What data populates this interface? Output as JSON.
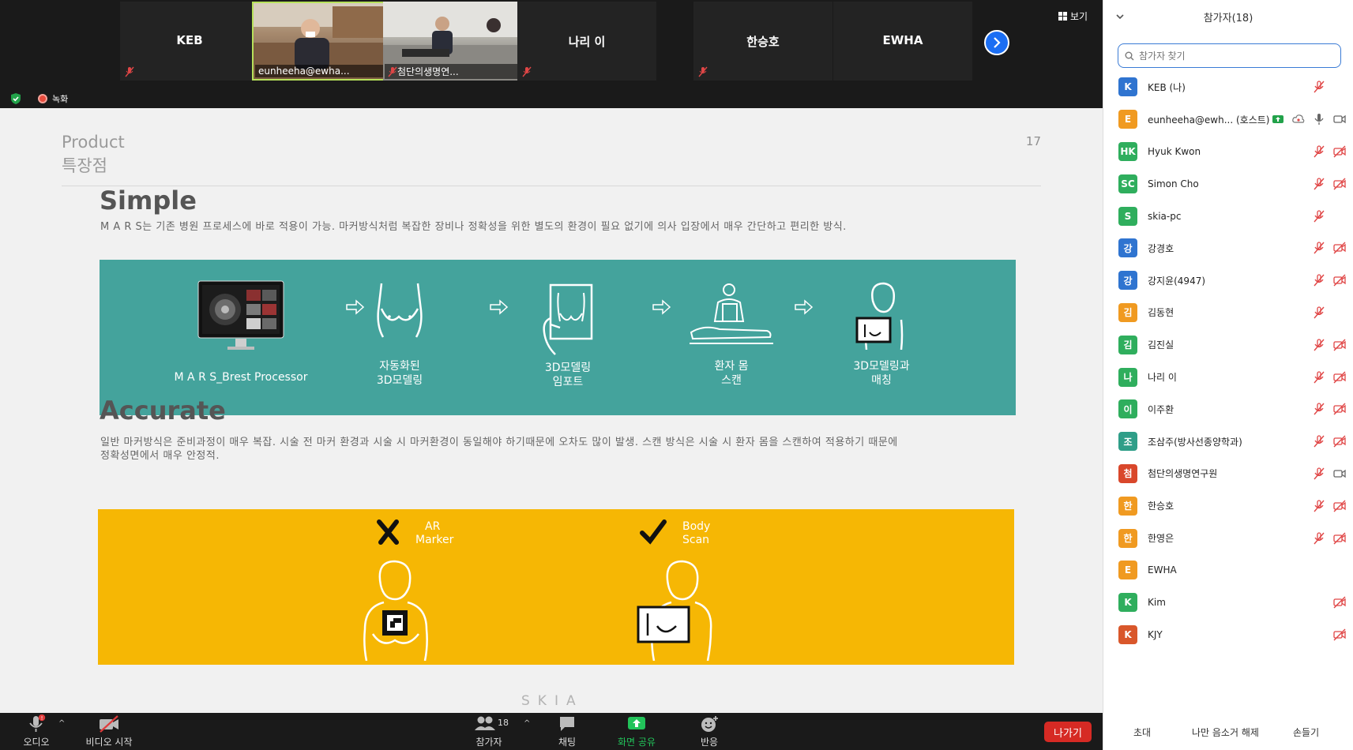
{
  "video_strip": {
    "tiles": [
      {
        "name": "KEB",
        "type": "name",
        "muted": true
      },
      {
        "name": "eunheeha@ewha...",
        "type": "video-a",
        "muted": false
      },
      {
        "name": "첨단의생명연...",
        "type": "video-b",
        "muted": true
      },
      {
        "name": "나리 이",
        "type": "name",
        "muted": true
      },
      {
        "name": "한승호",
        "type": "name",
        "muted": true
      },
      {
        "name": "EWHA",
        "type": "name",
        "muted": false
      }
    ],
    "view_label": "보기"
  },
  "status": {
    "recording_label": "녹화"
  },
  "slide": {
    "header_line1": "Product",
    "header_line2": "특장점",
    "page_number": "17",
    "simple": {
      "title": "Simple",
      "desc": "M A R S는 기존 병원 프로세스에 바로 적용이 가능.  마커방식처럼 복잡한 장비나  정확성을 위한 별도의 환경이 필요 없기에  의사 입장에서 매우 간단하고 편리한 방식."
    },
    "steps": [
      {
        "line1": "M A R S_Brest Processor",
        "line2": ""
      },
      {
        "line1": "자동화된",
        "line2": "3D모델링"
      },
      {
        "line1": "3D모델링",
        "line2": "임포트"
      },
      {
        "line1": "환자 몸",
        "line2": "스캔"
      },
      {
        "line1": "3D모델링과",
        "line2": "매칭"
      }
    ],
    "accurate": {
      "title": "Accurate",
      "desc_line1": "일반 마커방식은 준비과정이 매우 복잡. 시술 전 마커 환경과 시술 시 마커환경이 동일해야 하기때문에 오차도 많이 발생. 스캔 방식은 시술 시 환자 몸을 스캔하여 적용하기 때문에",
      "desc_line2": "정확성면에서 매우 안정적."
    },
    "options": [
      {
        "line1": "AR",
        "line2": "Marker",
        "mark": "cross"
      },
      {
        "line1": "Body",
        "line2": "Scan",
        "mark": "check"
      }
    ],
    "footer_brand": "SKIA"
  },
  "toolbar": {
    "audio_label": "오디오",
    "video_label": "비디오 시작",
    "participants_label": "참가자",
    "participants_count": "18",
    "chat_label": "채팅",
    "share_label": "화면 공유",
    "reactions_label": "반응",
    "leave_label": "나가기"
  },
  "panel": {
    "title": "참가자(18)",
    "search_placeholder": "참가자 찾기",
    "participants": [
      {
        "initials": "K",
        "name": "KEB (나)",
        "color": "#2f74d0",
        "mic": "off",
        "cam": "none"
      },
      {
        "initials": "E",
        "name": "eunheeha@ewh...  (호스트)",
        "color": "#f09a21",
        "mic": "on",
        "cam": "on",
        "host": true
      },
      {
        "initials": "HK",
        "name": "Hyuk Kwon",
        "color": "#2fae5d",
        "mic": "off",
        "cam": "off"
      },
      {
        "initials": "SC",
        "name": "Simon Cho",
        "color": "#2fae5d",
        "mic": "off",
        "cam": "off"
      },
      {
        "initials": "S",
        "name": "skia-pc",
        "color": "#2fae5d",
        "mic": "off",
        "cam": "none"
      },
      {
        "initials": "강",
        "name": "강경호",
        "color": "#2f74d0",
        "mic": "off",
        "cam": "off"
      },
      {
        "initials": "강",
        "name": "강지윤(4947)",
        "color": "#2f74d0",
        "mic": "off",
        "cam": "off"
      },
      {
        "initials": "김",
        "name": "김동현",
        "color": "#f09a21",
        "mic": "off",
        "cam": "none"
      },
      {
        "initials": "김",
        "name": "김진실",
        "color": "#2fae5d",
        "mic": "off",
        "cam": "off"
      },
      {
        "initials": "나",
        "name": "나리 이",
        "color": "#2fae5d",
        "mic": "off",
        "cam": "off"
      },
      {
        "initials": "이",
        "name": "이주환",
        "color": "#2fae5d",
        "mic": "off",
        "cam": "off"
      },
      {
        "initials": "조",
        "name": "조삼주(방사선종양학과)",
        "color": "#2f9e88",
        "mic": "off",
        "cam": "off"
      },
      {
        "initials": "첨",
        "name": "첨단의생명연구원",
        "color": "#d9472b",
        "mic": "off",
        "cam": "on"
      },
      {
        "initials": "한",
        "name": "한승호",
        "color": "#f09a21",
        "mic": "off",
        "cam": "off"
      },
      {
        "initials": "한",
        "name": "한영은",
        "color": "#f09a21",
        "mic": "off",
        "cam": "off"
      },
      {
        "initials": "E",
        "name": "EWHA",
        "color": "#f09a21",
        "mic": "none",
        "cam": "none"
      },
      {
        "initials": "K",
        "name": "Kim",
        "color": "#2fae5d",
        "mic": "none",
        "cam": "off"
      },
      {
        "initials": "K",
        "name": "KJY",
        "color": "#d9572b",
        "mic": "none",
        "cam": "off"
      }
    ],
    "footer": {
      "invite": "초대",
      "mute_me": "나만 음소거 해제",
      "raise_hand": "손들기"
    }
  },
  "colors": {
    "teal": "#44a39c",
    "yellow": "#f6b704",
    "leave": "#d62a24",
    "accent_blue": "#1b6ef3"
  }
}
